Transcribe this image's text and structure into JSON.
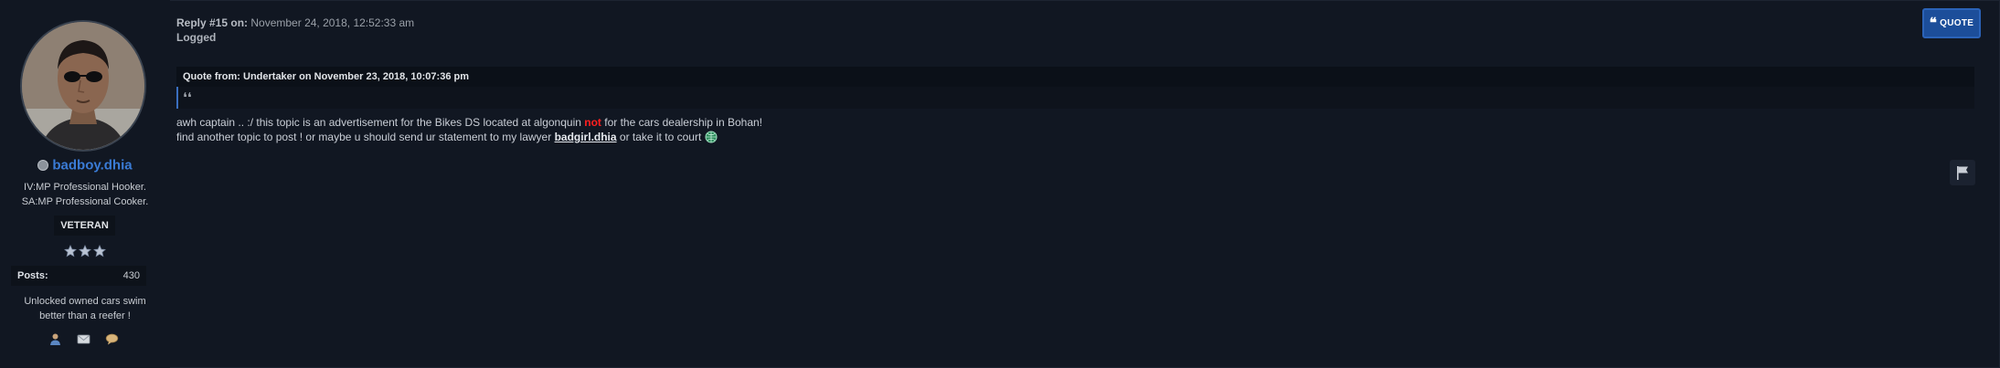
{
  "user": {
    "name": "badboy.dhia",
    "title_lines": [
      "IV:MP Professional Hooker.",
      "SA:MP Professional Cooker."
    ],
    "rank": "VETERAN",
    "posts_label": "Posts:",
    "posts_value": "430",
    "signature_lines": [
      "Unlocked owned cars swim",
      "better than a reefer !"
    ],
    "status": "offline",
    "star_count": 3
  },
  "post": {
    "reply_label": "Reply #15 on:",
    "timestamp": "November 24, 2018, 12:52:33 am",
    "logged": "Logged",
    "quote_button": "QUOTE",
    "quote_header": "Quote from: Undertaker on November 23, 2018, 10:07:36 pm",
    "quote_mark": "❛❛",
    "body_line1_pre": "awh captain .. :/ this topic is an advertisement for the Bikes DS located at algonquin ",
    "body_line1_red": "not",
    "body_line1_post": " for the cars dealership in Bohan!",
    "body_line2_pre": "find another topic to post ! or maybe u should send ur statement to my lawyer ",
    "body_line2_link": "badgirl.dhia",
    "body_line2_post": " or take it to court"
  },
  "icons": {
    "quote": "quote-icon",
    "profile": "profile-icon",
    "email": "email-icon",
    "pm": "speech-bubble-icon",
    "report": "flag-icon",
    "smiley": "globe-smiley-icon"
  },
  "colors": {
    "background": "#111722",
    "username": "#3a7bd5",
    "quote_button": "#1c4e9a",
    "highlight_red": "#ff2020"
  }
}
